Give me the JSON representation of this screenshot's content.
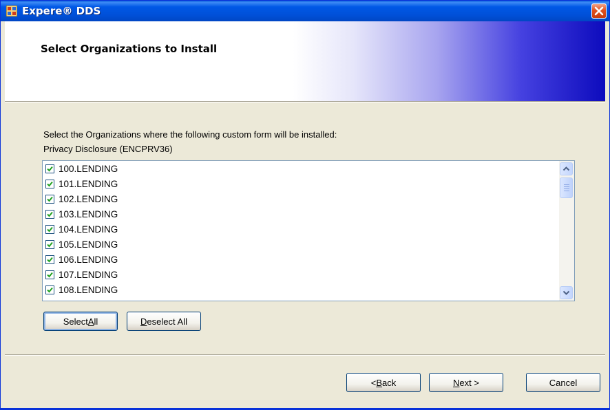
{
  "window": {
    "title": "Expere® DDS",
    "close_label": "×"
  },
  "header": {
    "title": "Select Organizations to Install"
  },
  "content": {
    "instruction": "Select the Organizations where the following custom form will be installed:",
    "form_name": "Privacy Disclosure (ENCPRV36)"
  },
  "organizations": [
    {
      "label": "100.LENDING",
      "checked": true
    },
    {
      "label": "101.LENDING",
      "checked": true
    },
    {
      "label": "102.LENDING",
      "checked": true
    },
    {
      "label": "103.LENDING",
      "checked": true
    },
    {
      "label": "104.LENDING",
      "checked": true
    },
    {
      "label": "105.LENDING",
      "checked": true
    },
    {
      "label": "106.LENDING",
      "checked": true
    },
    {
      "label": "107.LENDING",
      "checked": true
    },
    {
      "label": "108.LENDING",
      "checked": true
    }
  ],
  "buttons": {
    "select_all": {
      "text": "Select ",
      "accel": "A",
      "rest": "ll"
    },
    "deselect_all": {
      "text": "",
      "accel": "D",
      "rest": "eselect All"
    },
    "back": {
      "text": "< ",
      "accel": "B",
      "rest": "ack"
    },
    "next": {
      "text": "",
      "accel": "N",
      "rest": "ext >"
    },
    "cancel": "Cancel"
  },
  "colors": {
    "titlebar": "#0058e6",
    "checkmark": "#21a121",
    "dialog_bg": "#ece9d8",
    "list_border": "#7f9db9"
  }
}
